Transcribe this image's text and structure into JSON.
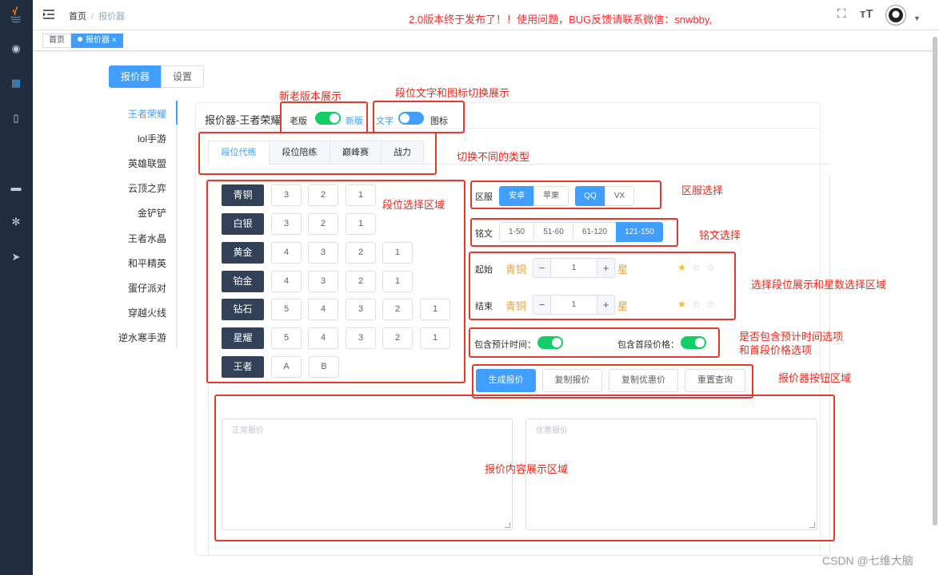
{
  "navbar": {
    "breadcrumb_home": "首页",
    "breadcrumb_current": "报价器",
    "notice": "2.0版本终于发布了！！使用问题，BUG反馈请联系微信：snwbby,"
  },
  "tags": {
    "home": "首页",
    "current": "报价器"
  },
  "page_tabs": {
    "quoter": "报价器",
    "settings": "设置"
  },
  "games": [
    "王者荣耀",
    "lol手游",
    "英雄联盟",
    "云顶之弈",
    "金铲铲",
    "王者水晶",
    "和平精英",
    "蛋仔派对",
    "穿越火线",
    "逆水寒手游"
  ],
  "card": {
    "title": "报价器-王者荣耀",
    "old_version": "老版",
    "new_version": "新版",
    "text_mode": "文字",
    "icon_mode": "图标"
  },
  "type_tabs": [
    "段位代练",
    "段位陪练",
    "巅峰赛",
    "战力"
  ],
  "ranks": [
    {
      "name": "青铜",
      "levels": [
        "3",
        "2",
        "1"
      ]
    },
    {
      "name": "白银",
      "levels": [
        "3",
        "2",
        "1"
      ]
    },
    {
      "name": "黄金",
      "levels": [
        "4",
        "3",
        "2",
        "1"
      ]
    },
    {
      "name": "铂金",
      "levels": [
        "4",
        "3",
        "2",
        "1"
      ]
    },
    {
      "name": "钻石",
      "levels": [
        "5",
        "4",
        "3",
        "2",
        "1"
      ]
    },
    {
      "name": "星耀",
      "levels": [
        "5",
        "4",
        "3",
        "2",
        "1"
      ]
    },
    {
      "name": "王者",
      "levels": [
        "A",
        "B"
      ]
    }
  ],
  "server": {
    "label": "区服",
    "platforms": [
      "安卓",
      "苹果"
    ],
    "accounts": [
      "QQ",
      "VX"
    ]
  },
  "inscription": {
    "label": "铭文",
    "options": [
      "1-50",
      "51-60",
      "61-120",
      "121-150"
    ]
  },
  "start": {
    "label": "起始",
    "rank": "青铜",
    "minus": "−",
    "plus": "+",
    "value": "1",
    "star_label": "星",
    "stars_filled": 1,
    "stars_total": 3
  },
  "end": {
    "label": "结束",
    "rank": "青铜",
    "minus": "−",
    "plus": "+",
    "value": "1",
    "star_label": "星",
    "stars_filled": 1,
    "stars_total": 3
  },
  "options": {
    "include_time": "包含预计时间：",
    "include_first_price": "包含首段价格："
  },
  "actions": {
    "generate": "生成报价",
    "copy": "复制报价",
    "copy_discount": "复制优惠价",
    "reset": "重置查询"
  },
  "output": {
    "normal_placeholder": "正常报价",
    "discount_placeholder": "优惠报价"
  },
  "annotations": {
    "version": "新老版本展示",
    "display_mode": "段位文字和图标切换展示",
    "types": "切换不同的类型",
    "rank_area": "段位选择区域",
    "server": "区服选择",
    "inscription": "铭文选择",
    "rank_star": "选择段位展示和星数选择区域",
    "options_line1": "是否包含预计时间选项",
    "options_line2": "和首段价格选项",
    "buttons": "报价器按钮区域",
    "output": "报价内容展示区域"
  },
  "watermark": "CSDN @七维大脑",
  "colors": {
    "sidebar": "#1f2d3d",
    "primary": "#409eff",
    "switch_on": "#13ce66",
    "rank_btn": "#324157",
    "rank_text": "#e6a23c",
    "annotation": "#e53a2b"
  }
}
